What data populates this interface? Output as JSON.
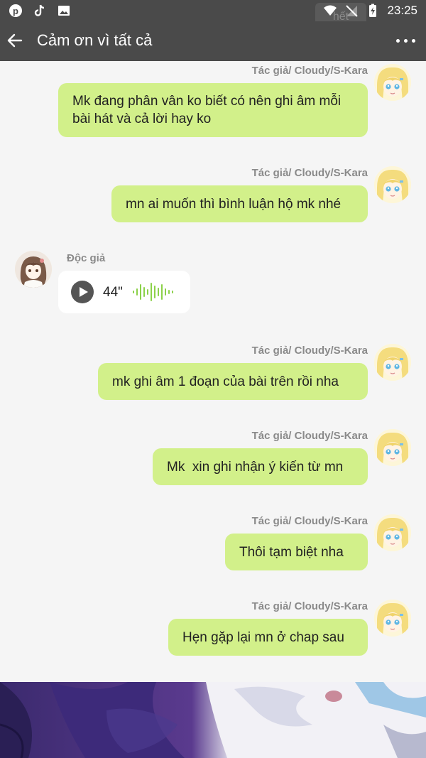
{
  "status_bar": {
    "time": "23:25",
    "left_icons": [
      "pinterest-icon",
      "tiktok-icon",
      "gallery-icon"
    ],
    "right_icons": [
      "wifi-icon",
      "signal-off-icon",
      "battery-charging-icon"
    ],
    "ghost_chip": "hết"
  },
  "app_bar": {
    "title": "Cảm ơn vì tất cả",
    "back_icon": "arrow-left-icon",
    "menu_icon": "more-horizontal-icon"
  },
  "messages": [
    {
      "sender": "Tác giả/ Cloudy/S-Kara",
      "text": "Mk đang phân vân ko biết có nên ghi âm mỗi bài hát và cả lời hay ko"
    },
    {
      "sender": "Tác giả/ Cloudy/S-Kara",
      "text": "mn ai muốn thì bình luận hộ mk nhé"
    },
    {
      "sender": "Độc giả",
      "voice_duration": "44\""
    },
    {
      "sender": "Tác giả/ Cloudy/S-Kara",
      "text": "mk ghi âm 1 đoạn của bài trên rồi nha"
    },
    {
      "sender": "Tác giả/ Cloudy/S-Kara",
      "text": "Mk  xin ghi nhận ý kiến từ mn"
    },
    {
      "sender": "Tác giả/ Cloudy/S-Kara",
      "text": "Thôi tạm biệt nha"
    },
    {
      "sender": "Tác giả/ Cloudy/S-Kara",
      "text": "Hẹn gặp lại mn ở chap sau"
    }
  ],
  "colors": {
    "bar": "#4a4a4a",
    "bubble": "#d2f08a",
    "background": "#f5f5f5",
    "wave": "#8cd14a"
  }
}
